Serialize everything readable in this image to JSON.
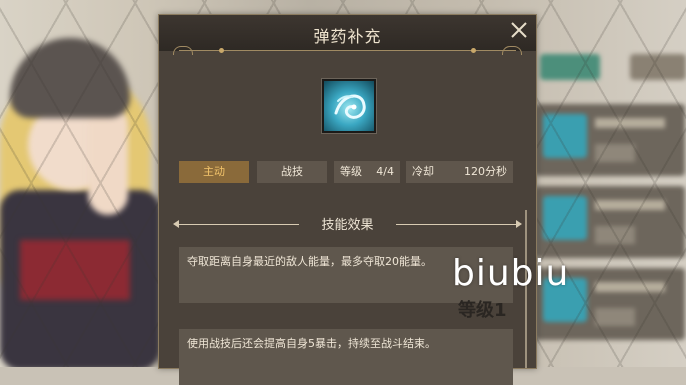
{
  "dialog": {
    "title": "弹药补充",
    "skill_icon": "ammo-swirl-icon",
    "stats": {
      "active_label": "主动",
      "type_label": "战技",
      "level_label": "等级",
      "level_value": "4/4",
      "cooldown_label": "冷却",
      "cooldown_value": "120分秒"
    },
    "section_title": "技能效果",
    "effects": [
      "夺取距离自身最近的敌人能量，最多夺取20能量。",
      "使用战技后还会提高自身5暴击，持续至战斗结束。"
    ]
  },
  "watermark": {
    "brand": "biubiu",
    "level": "等级1"
  },
  "colors": {
    "panel_bg": "#4a423a",
    "active_tag": "#f3c46b",
    "accent_gold": "#a08a62"
  }
}
